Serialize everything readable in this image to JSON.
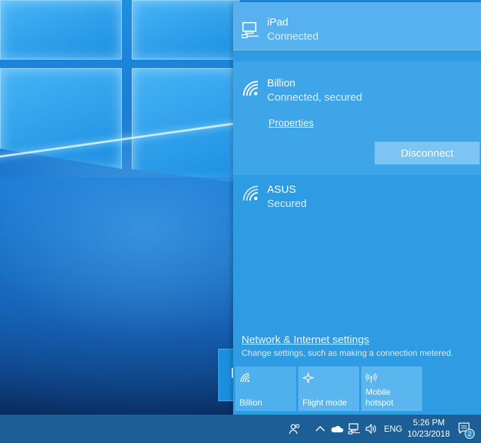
{
  "networks": [
    {
      "name": "iPad",
      "status": "Connected",
      "icon": "ethernet-icon"
    },
    {
      "name": "Billion",
      "status": "Connected, secured",
      "icon": "wifi-icon",
      "properties_label": "Properties",
      "disconnect_label": "Disconnect"
    },
    {
      "name": "ASUS",
      "status": "Secured",
      "icon": "wifi-icon"
    }
  ],
  "settings": {
    "link": "Network & Internet settings",
    "description": "Change settings, such as making a connection metered."
  },
  "tiles": [
    {
      "label": "Billion",
      "icon": "wifi-icon"
    },
    {
      "label": "Flight mode",
      "icon": "airplane-icon"
    },
    {
      "label": "Mobile\nhotspot",
      "icon": "hotspot-icon"
    }
  ],
  "taskbar": {
    "language": "ENG",
    "time": "5:26 PM",
    "date": "10/23/2018",
    "notification_count": "2"
  },
  "colors": {
    "flyout_bg": "#2f9be3",
    "selected_item_bg": "#57b1ee",
    "taskbar_bg": "#1c5f97"
  }
}
